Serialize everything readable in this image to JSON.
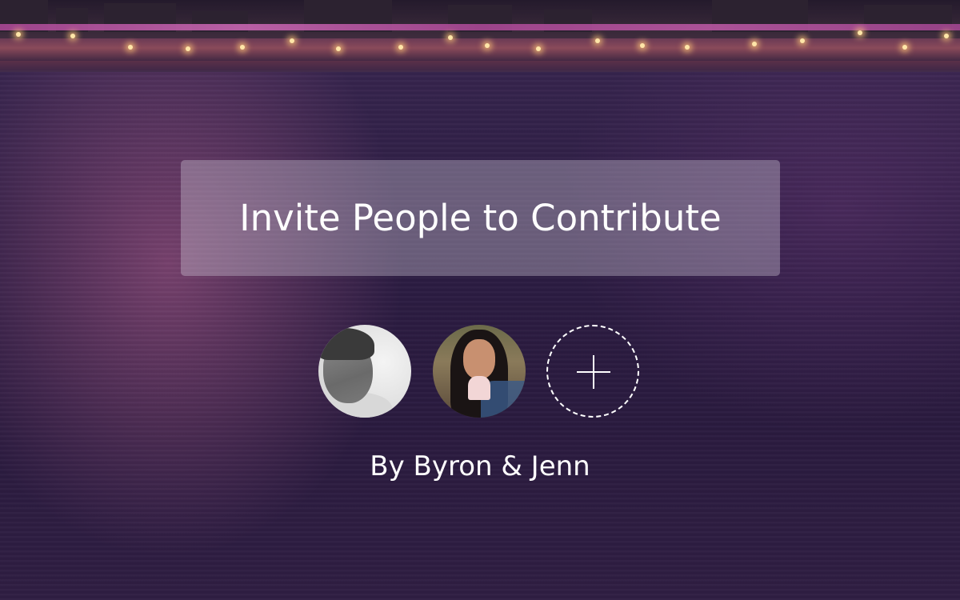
{
  "invite": {
    "label": "Invite People to Contribute"
  },
  "contributors": {
    "avatars": [
      {
        "name": "Byron",
        "icon": "avatar-photo"
      },
      {
        "name": "Jenn",
        "icon": "avatar-photo"
      }
    ],
    "add_icon": "plus-icon"
  },
  "byline": {
    "text": "By Byron & Jenn"
  },
  "colors": {
    "text": "#ffffff",
    "button_bg": "rgba(205,198,214,0.38)",
    "water": "#2b1c42",
    "accent_glow": "#d06ab8"
  }
}
